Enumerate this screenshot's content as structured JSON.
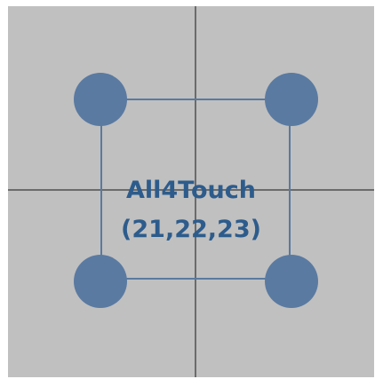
{
  "gesture": {
    "name": "All4Touch",
    "ids": "(21,22,23)"
  },
  "touch_points": [
    {
      "id": "top-left"
    },
    {
      "id": "top-right"
    },
    {
      "id": "bottom-left"
    },
    {
      "id": "bottom-right"
    }
  ],
  "colors": {
    "panel_bg": "#c0c0c0",
    "axis": "#6b6b6b",
    "accent": "#5a7aa1",
    "label": "#2d5c8c"
  }
}
